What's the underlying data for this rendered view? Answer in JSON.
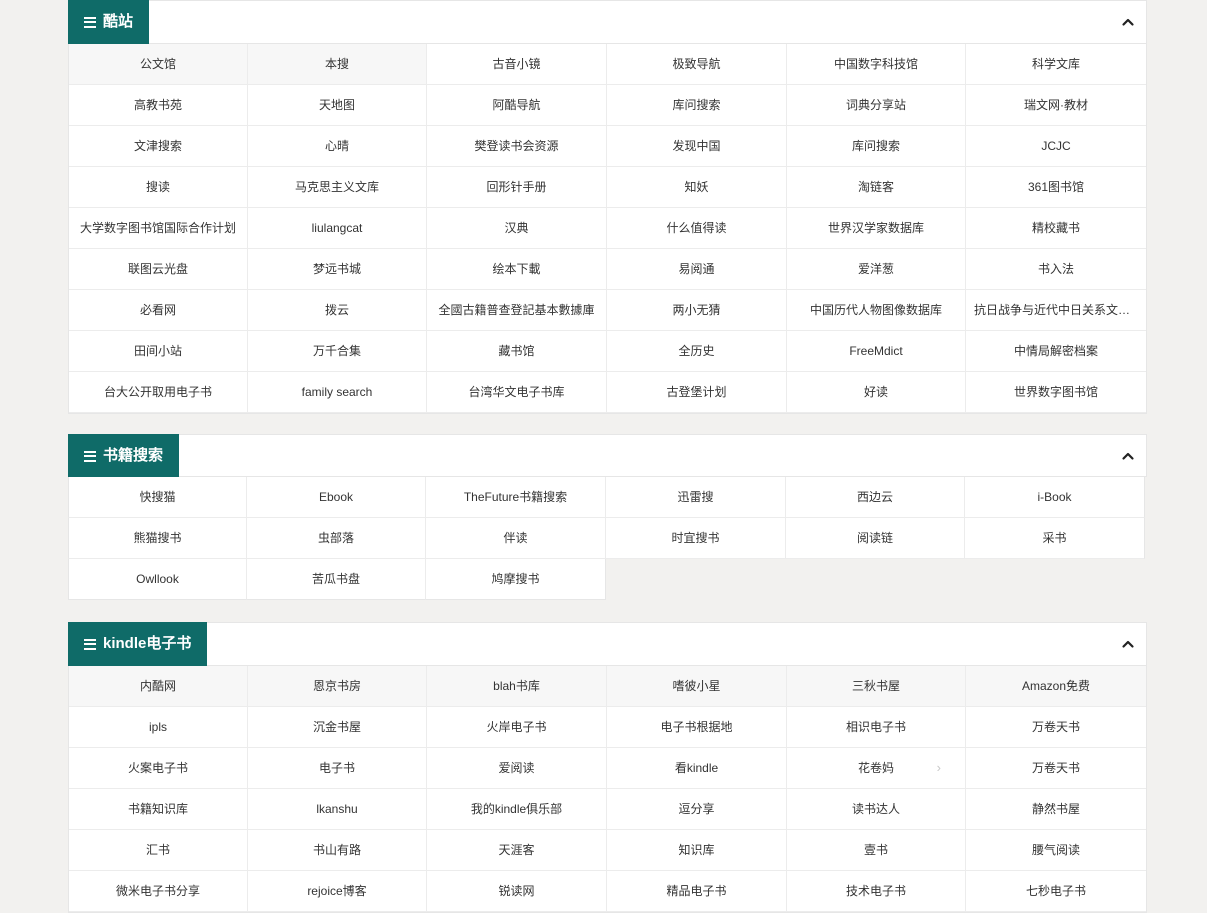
{
  "sections": [
    {
      "title": "酷站",
      "items": [
        "公文馆",
        "本搜",
        "古音小镜",
        "极致导航",
        "中国数字科技馆",
        "科学文库",
        "高教书苑",
        "天地图",
        "阿酷导航",
        "库问搜索",
        "词典分享站",
        "瑞文网·教材",
        "文津搜索",
        "心晴",
        "樊登读书会资源",
        "发现中国",
        "库问搜索",
        "JCJC",
        "搜读",
        "马克思主义文库",
        "回形针手册",
        "知妖",
        "淘链客",
        "361图书馆",
        "大学数字图书馆国际合作计划",
        "liulangcat",
        "汉典",
        "什么值得读",
        "世界汉学家数据库",
        "精校藏书",
        "联图云光盘",
        "梦远书城",
        "绘本下載",
        "易阅通",
        "爱洋葱",
        "书入法",
        "必看网",
        "拨云",
        "全國古籍普查登記基本數據庫",
        "两小无猜",
        "中国历代人物图像数据库",
        "抗日战争与近代中日关系文献数据平台",
        "田间小站",
        "万千合集",
        "藏书馆",
        "全历史",
        "FreeMdict",
        "中情局解密档案",
        "台大公开取用电子书",
        "family search",
        "台湾华文电子书库",
        "古登堡计划",
        "好读",
        "世界数字图书馆"
      ]
    },
    {
      "title": "书籍搜索",
      "items": [
        "快搜猫",
        "Ebook",
        "TheFuture书籍搜索",
        "迅雷搜",
        "西边云",
        "i-Book",
        "熊猫搜书",
        "虫部落",
        "伴读",
        "时宜搜书",
        "阅读链",
        "采书",
        "Owllook",
        "苦瓜书盘",
        "鸠摩搜书"
      ]
    },
    {
      "title": "kindle电子书",
      "items": [
        "内酷网",
        "恩京书房",
        "blah书库",
        "嗜彼小星",
        "三秋书屋",
        "Amazon免费",
        "ipls",
        "沉金书屋",
        "火岸电子书",
        "电子书根据地",
        "相识电子书",
        "万卷天书",
        "火案电子书",
        "电子书",
        "爱阅读",
        "看kindle",
        "花卷妈",
        "万卷天书",
        "书籍知识库",
        "lkanshu",
        "我的kindle俱乐部",
        "逗分享",
        "读书达人",
        "静然书屋",
        "汇书",
        "书山有路",
        "天涯客",
        "知识库",
        "壹书",
        "腰气阅读",
        "微米电子书分享",
        "rejoice博客",
        "锐读网",
        "精品电子书",
        "技术电子书",
        "七秒电子书"
      ]
    }
  ],
  "icons": {
    "menu": "menu-icon",
    "collapse": "chevron-up-icon",
    "hover_arrow": "chevron-right-icon"
  },
  "colors": {
    "accent": "#0f6b68",
    "background": "#f2f1ef"
  }
}
